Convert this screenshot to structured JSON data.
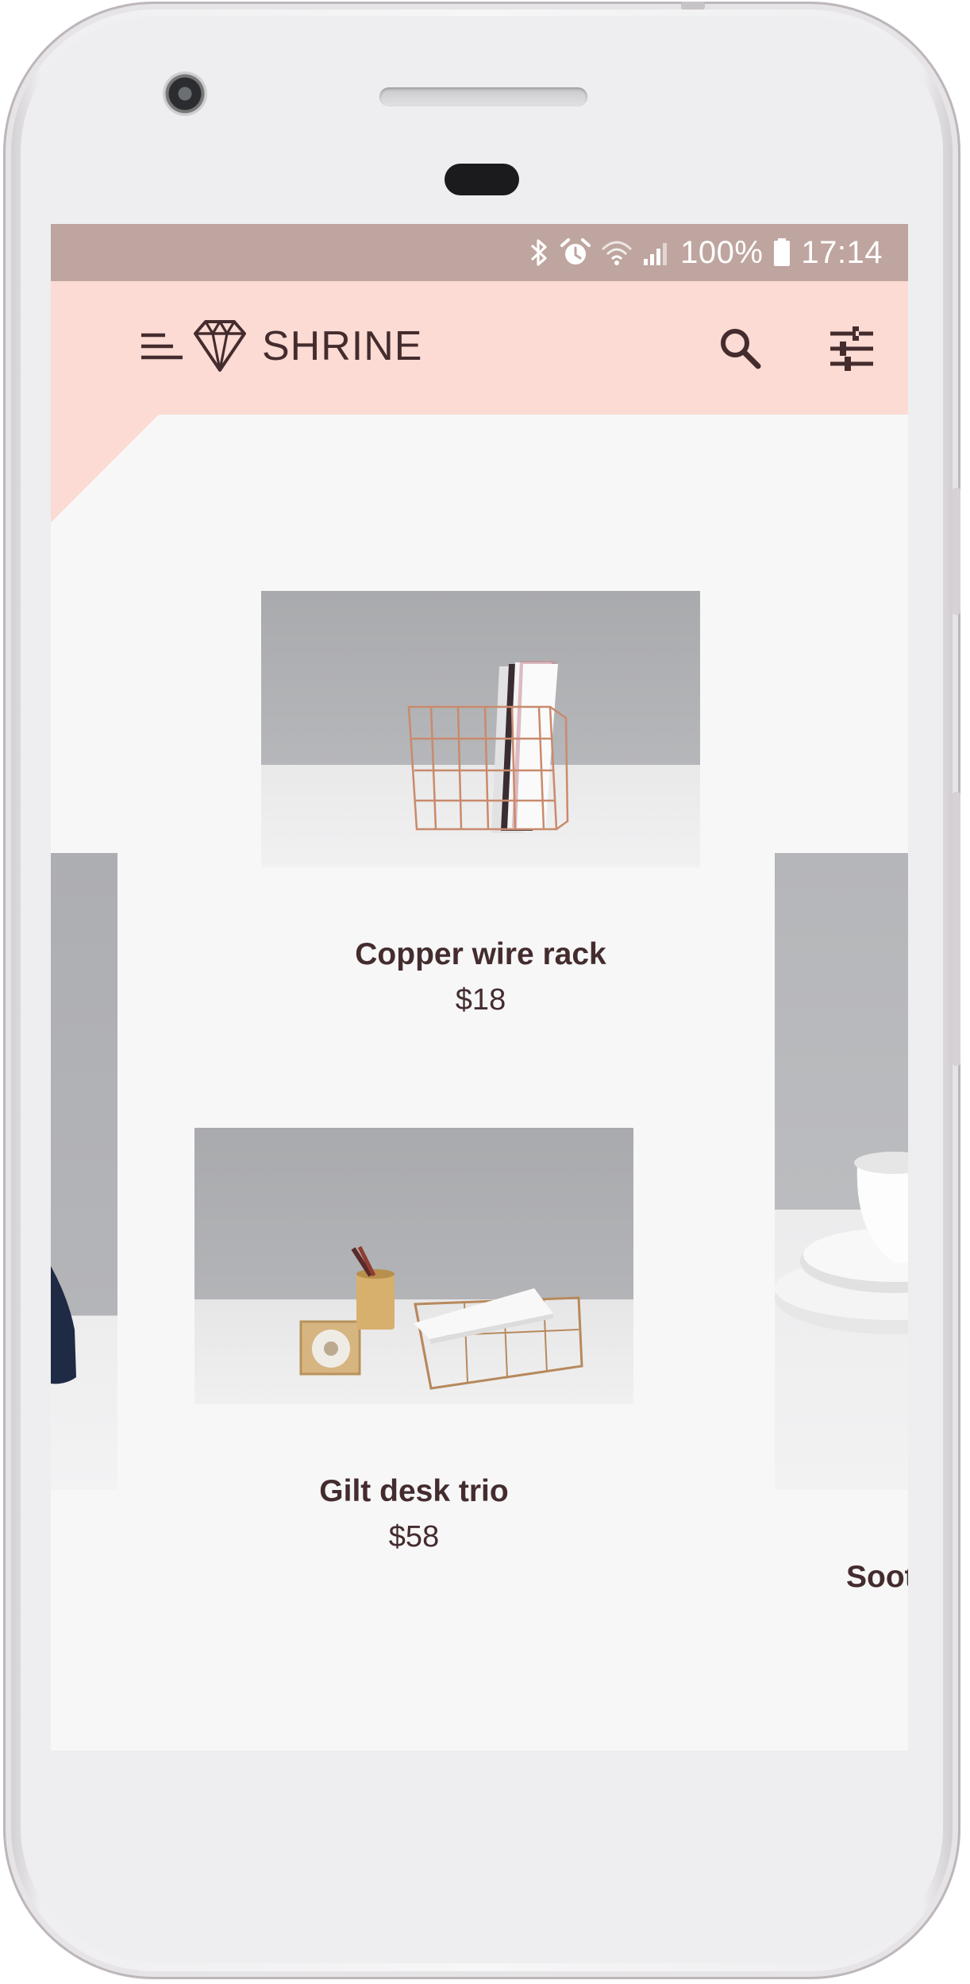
{
  "status_bar": {
    "battery": "100%",
    "time": "17:14",
    "icons": [
      "bluetooth-icon",
      "alarm-icon",
      "wifi-icon",
      "signal-icon",
      "battery-icon"
    ]
  },
  "app_bar": {
    "brand": "SHRINE",
    "icons": [
      "menu-icon",
      "diamond-logo-icon",
      "search-icon",
      "tune-icon"
    ]
  },
  "products": [
    {
      "title": "Copper wire rack",
      "price": "$18"
    },
    {
      "title": "Gilt desk trio",
      "price": "$58"
    },
    {
      "title": "Soot",
      "price": ""
    }
  ],
  "colors": {
    "status_bar": "#bfa59f",
    "app_bar": "#fbdbd3",
    "text": "#442c2e",
    "background": "#f7f7f8"
  }
}
